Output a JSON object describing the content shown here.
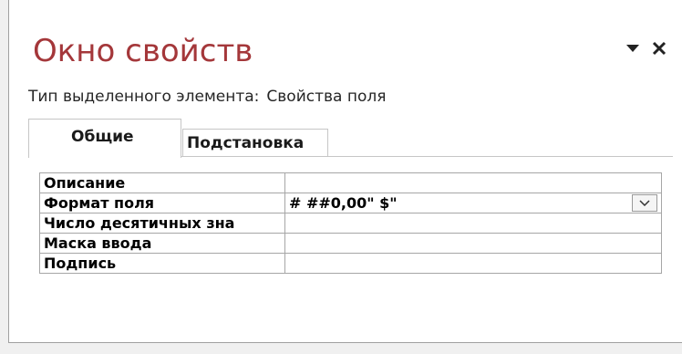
{
  "pane": {
    "title": "Окно свойств",
    "selection_label": "Тип выделенного элемента:",
    "selection_value": "Свойства поля",
    "title_color": "#a4373a",
    "controls": {
      "menu_icon": "chevron-down-triangle-icon",
      "close_icon": "close-icon"
    }
  },
  "tabs": [
    {
      "label": "Общие",
      "active": true
    },
    {
      "label": "Подстановка",
      "active": false
    }
  ],
  "properties": [
    {
      "label": "Описание",
      "value": ""
    },
    {
      "label": "Формат поля",
      "value": "# ##0,00\" $\"",
      "has_dropdown": true
    },
    {
      "label": "Число десятичных зна",
      "value": ""
    },
    {
      "label": "Маска ввода",
      "value": ""
    },
    {
      "label": "Подпись",
      "value": ""
    }
  ]
}
